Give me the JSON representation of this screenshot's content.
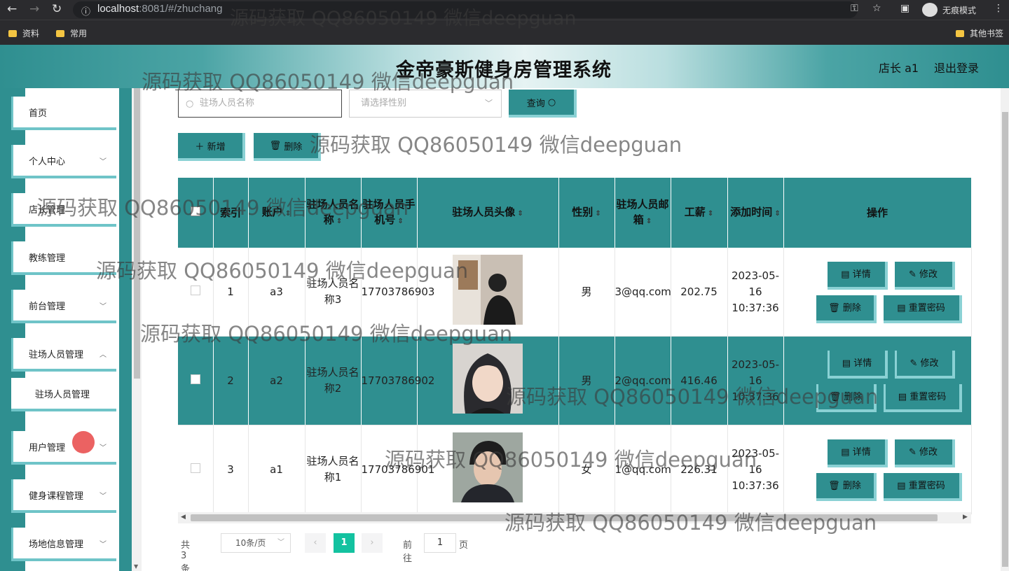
{
  "browser": {
    "url_host": "localhost",
    "url_rest": ":8081/#/zhuchang",
    "incognito_label": "无痕模式",
    "bookmarks": [
      "资料",
      "常用"
    ],
    "other_bookmarks": "其他书签"
  },
  "header": {
    "title": "金帝豪斯健身房管理系统",
    "role": "店长 a1",
    "logout": "退出登录"
  },
  "sidebar": {
    "items": [
      {
        "label": "首页",
        "expandable": false
      },
      {
        "label": "个人中心",
        "expandable": true
      },
      {
        "label": "店长管理",
        "expandable": false
      },
      {
        "label": "教练管理",
        "expandable": false
      },
      {
        "label": "前台管理",
        "expandable": true
      },
      {
        "label": "驻场人员管理",
        "expandable": true
      },
      {
        "label": "驻场人员管理",
        "sub": true
      },
      {
        "label": "用户管理",
        "expandable": true
      },
      {
        "label": "健身课程管理",
        "expandable": true
      },
      {
        "label": "场地信息管理",
        "expandable": true
      }
    ]
  },
  "toolbar": {
    "search_placeholder": "驻场人员名称",
    "gender_placeholder": "请选择性别",
    "query_label": "查询",
    "add_label": "新增",
    "delete_label": "删除"
  },
  "table": {
    "headers": {
      "index": "索引",
      "account": "账户",
      "name": "驻场人员名称",
      "phone": "驻场人员手机号",
      "avatar": "驻场人员头像",
      "gender": "性别",
      "email": "驻场人员邮箱",
      "salary": "工薪",
      "added": "添加时间",
      "ops": "操作"
    },
    "rows": [
      {
        "index": "1",
        "account": "a3",
        "name": "驻场人员名称3",
        "phone": "17703786903",
        "gender": "男",
        "email": "3@qq.com",
        "salary": "202.75",
        "added": "2023-05-16 10:37:36"
      },
      {
        "index": "2",
        "account": "a2",
        "name": "驻场人员名称2",
        "phone": "17703786902",
        "gender": "男",
        "email": "2@qq.com",
        "salary": "416.46",
        "added": "2023-05-16 10:37:36"
      },
      {
        "index": "3",
        "account": "a1",
        "name": "驻场人员名称1",
        "phone": "17703786901",
        "gender": "女",
        "email": "1@qq.com",
        "salary": "226.31",
        "added": "2023-05-16 10:37:36"
      }
    ],
    "ops": {
      "detail": "详情",
      "edit": "修改",
      "delete": "删除",
      "reset": "重置密码"
    }
  },
  "pagination": {
    "total": "共 3 条",
    "page_size": "10条/页",
    "current_page": "1",
    "goto_label": "前往",
    "goto_value": "1",
    "page_unit": "页"
  },
  "watermark": "源码获取 QQ86050149 微信deepguan",
  "colors": {
    "primary": "#2f8f90",
    "accent": "#8ad1d4",
    "page_active": "#13c2a0"
  }
}
